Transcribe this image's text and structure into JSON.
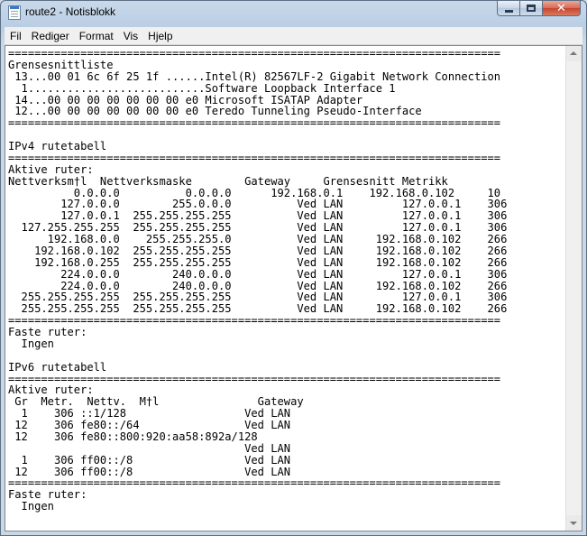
{
  "window": {
    "title": "route2 - Notisblokk",
    "close_glyph": "✕"
  },
  "menu": [
    "Fil",
    "Rediger",
    "Format",
    "Vis",
    "Hjelp"
  ],
  "document": {
    "lines": [
      "===========================================================================",
      "Grensesnittliste",
      " 13...00 01 6c 6f 25 1f ......Intel(R) 82567LF-2 Gigabit Network Connection",
      "  1...........................Software Loopback Interface 1",
      " 14...00 00 00 00 00 00 00 e0 Microsoft ISATAP Adapter",
      " 12...00 00 00 00 00 00 00 e0 Teredo Tunneling Pseudo-Interface",
      "===========================================================================",
      "",
      "IPv4 rutetabell",
      "===========================================================================",
      "Aktive ruter:",
      "Nettverksm†l  Nettverksmaske        Gateway     Grensesnitt Metrikk",
      "          0.0.0.0          0.0.0.0      192.168.0.1    192.168.0.102     10",
      "        127.0.0.0        255.0.0.0          Ved LAN         127.0.0.1    306",
      "        127.0.0.1  255.255.255.255          Ved LAN         127.0.0.1    306",
      "  127.255.255.255  255.255.255.255          Ved LAN         127.0.0.1    306",
      "      192.168.0.0    255.255.255.0          Ved LAN     192.168.0.102    266",
      "    192.168.0.102  255.255.255.255          Ved LAN     192.168.0.102    266",
      "    192.168.0.255  255.255.255.255          Ved LAN     192.168.0.102    266",
      "        224.0.0.0        240.0.0.0          Ved LAN         127.0.0.1    306",
      "        224.0.0.0        240.0.0.0          Ved LAN     192.168.0.102    266",
      "  255.255.255.255  255.255.255.255          Ved LAN         127.0.0.1    306",
      "  255.255.255.255  255.255.255.255          Ved LAN     192.168.0.102    266",
      "===========================================================================",
      "Faste ruter:",
      "  Ingen",
      "",
      "IPv6 rutetabell",
      "===========================================================================",
      "Aktive ruter:",
      " Gr  Metr.  Nettv.  M†l               Gateway",
      "  1    306 ::1/128                  Ved LAN",
      " 12    306 fe80::/64                Ved LAN",
      " 12    306 fe80::800:920:aa58:892a/128",
      "                                    Ved LAN",
      "  1    306 ff00::/8                 Ved LAN",
      " 12    306 ff00::/8                 Ved LAN",
      "===========================================================================",
      "Faste ruter:",
      "  Ingen"
    ]
  }
}
